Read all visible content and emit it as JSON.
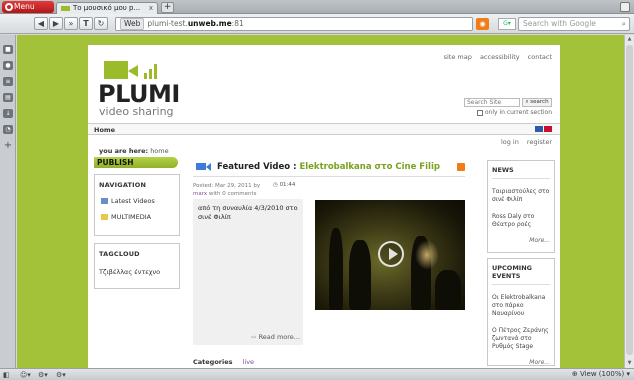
{
  "browser": {
    "menu_label": "Menu",
    "tab_title": "Το μουσικό μου p...",
    "tab_close": "x",
    "new_tab": "+",
    "url_badge": "Web",
    "url_prefix": "plumi-test.",
    "url_host": "unweb.me",
    "url_port": ":81",
    "search_placeholder": "Search with Google",
    "zoom_label": "View (100%)"
  },
  "site": {
    "logo_name": "PLUMI",
    "logo_tagline": "video sharing",
    "top_links": [
      "site map",
      "accessibility",
      "contact"
    ],
    "search_placeholder": "Search Site",
    "search_button": "search",
    "only_current": "only in current section",
    "home_link": "Home",
    "login_links": [
      "log in",
      "register"
    ],
    "breadcrumb_label": "you are here:",
    "breadcrumb_home": "home"
  },
  "sidebar": {
    "publish_label": "PUBLISH",
    "navigation_title": "NAVIGATION",
    "nav_items": [
      "Latest Videos",
      "MULTIMEDIA"
    ],
    "tagcloud_title": "TAGCLOUD",
    "tags": [
      "Τζιβέλλας έντεχνο"
    ]
  },
  "featured": {
    "label": "Featured Video :",
    "title": "Elektrobalkana στο Cine Filip",
    "posted": "Posted: Mar 29, 2011 by",
    "author": "marx",
    "comments": "with 0 comments",
    "duration": "01:44",
    "description": "από τη συναυλία 4/3/2010 στο σινέ Φιλίπ",
    "read_more": "Read more...",
    "categories_label": "Categories",
    "category": "live"
  },
  "news": {
    "title": "NEWS",
    "items": [
      "Ταιριαστούλες στο σινέ Φιλίπ",
      "Ross Daly στο Θέατρο ροές"
    ],
    "more": "More..."
  },
  "events": {
    "title": "UPCOMING EVENTS",
    "items": [
      "Οι Elektrobalkana στο πάρκο Ναυαρίνου",
      "Ο Πέτρος Ζεράνης ζωντανά στο Ρυθμός Stage"
    ],
    "more": "More..."
  },
  "colors": {
    "brand_green": "#a4c13a",
    "link_green": "#7aa21f",
    "opera_red": "#c82020",
    "rss_orange": "#f07d18"
  }
}
